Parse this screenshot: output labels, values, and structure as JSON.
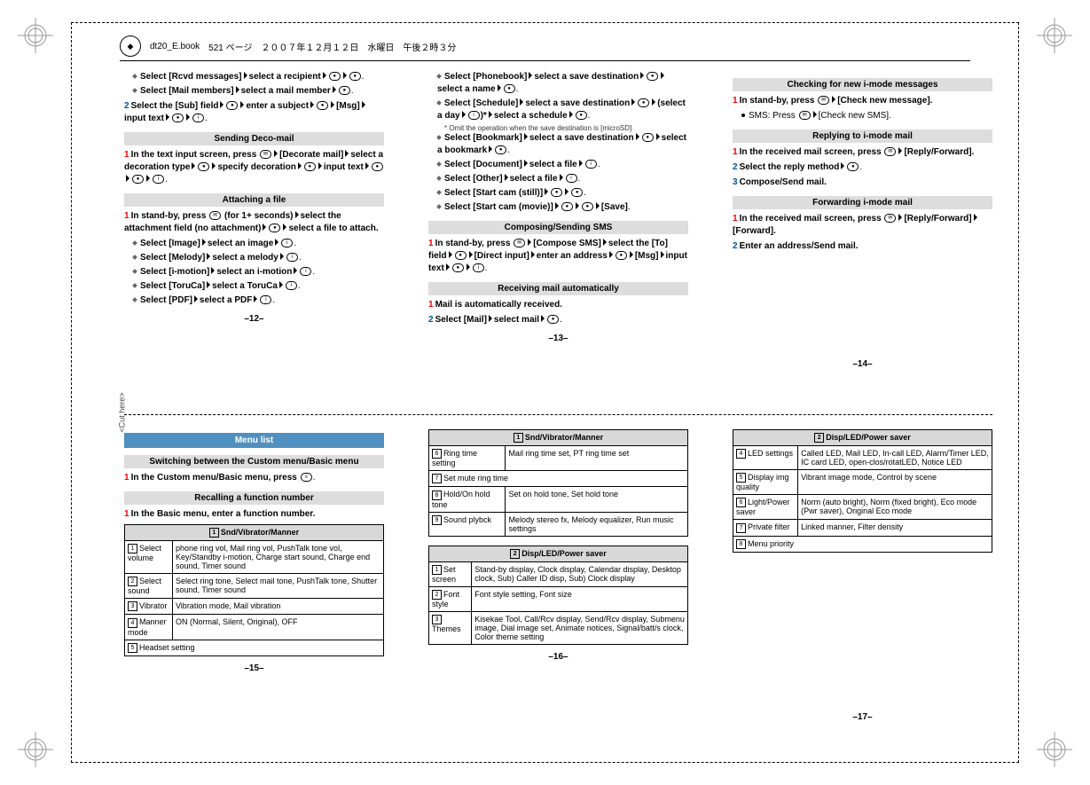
{
  "header": {
    "book": "dt20_E.book",
    "page": "521 ページ",
    "date": "２００７年１２月１２日　水曜日　午後２時３分"
  },
  "cut_here": "<Cut here>",
  "page12": {
    "rcvd": "Select [Rcvd messages]",
    "rcvd2": "select a recipient",
    "mailmem": "Select [Mail members]",
    "mailmem2": "select a mail member",
    "step2": "Select the [Sub] field",
    "step2b": "enter a subject",
    "step2c": "[Msg]",
    "step2d": "input text",
    "deco_head": "Sending Deco-mail",
    "deco1": "In the text input screen, press",
    "deco1b": "[Decorate mail]",
    "deco1c": "select a decoration type",
    "deco1d": "specify decoration",
    "deco1e": "input text",
    "attach_head": "Attaching a file",
    "attach1": "In stand-by, press",
    "attach1b": "(for 1+ seconds)",
    "attach1c": "select the attachment field (no attachment)",
    "attach1d": "select a file to attach.",
    "img": "Select [Image]",
    "img2": "select an image",
    "mel": "Select [Melody]",
    "mel2": "select a melody",
    "imot": "Select [i-motion]",
    "imot2": "select an i-motion",
    "toru": "Select [ToruCa]",
    "toru2": "select a ToruCa",
    "pdf": "Select [PDF]",
    "pdf2": "select a PDF",
    "pnum": "–12–"
  },
  "page13": {
    "pb": "Select [Phonebook]",
    "pb2": "select a save destination",
    "pb3": "select a name",
    "sch": "Select [Schedule]",
    "sch2": "select a save destination",
    "sch3": "(select a day",
    "sch4": "select a schedule",
    "note": "Omit the operation when the save destination is [microSD]",
    "bk": "Select [Bookmark]",
    "bk2": "select a save destination",
    "bk3": "select a bookmark",
    "doc": "Select [Document]",
    "doc2": "select a file",
    "oth": "Select [Other]",
    "oth2": "select a file",
    "still": "Select [Start cam (still)]",
    "mov": "Select [Start cam (movie)]",
    "mov2": "[Save]",
    "sms_head": "Composing/Sending SMS",
    "sms1": "In stand-by, press",
    "sms1b": "[Compose SMS]",
    "sms1c": "select the [To] field",
    "sms1d": "[Direct input]",
    "sms1e": "enter an address",
    "sms1f": "[Msg]",
    "sms1g": "input text",
    "recv_head": "Receiving mail automatically",
    "recv1": "Mail is automatically received.",
    "recv2": "Select [Mail]",
    "recv2b": "select mail",
    "pnum": "–13–"
  },
  "page14": {
    "check_head": "Checking for new i-mode messages",
    "check1": "In stand-by, press",
    "check1b": "[Check new message].",
    "check_sms": "SMS: Press",
    "check_sms2": "[Check new SMS].",
    "reply_head": "Replying to i-mode mail",
    "reply1": "In the received mail screen, press",
    "reply1b": "[Reply/Forward].",
    "reply2": "Select the reply method",
    "reply3": "Compose/Send mail.",
    "fwd_head": "Forwarding i-mode mail",
    "fwd1": "In the received mail screen, press",
    "fwd1b": "[Reply/Forward]",
    "fwd1c": "[Forward].",
    "fwd2": "Enter an address/Send mail.",
    "pnum": "–14–"
  },
  "page15": {
    "menu_head": "Menu list",
    "switch_head": "Switching between the Custom menu/Basic menu",
    "switch1": "In the Custom menu/Basic menu, press",
    "recall_head": "Recalling a function number",
    "recall1": "In the Basic menu, enter a function number.",
    "table_head": "Snd/Vibrator/Manner",
    "th_num": "1",
    "r1": "Select volume",
    "r1v": "phone ring vol, Mail ring vol, PushTalk tone vol, Key/Standby i-motion, Charge start sound, Charge end sound, Timer sound",
    "r2": "Select sound",
    "r2v": "Select ring tone, Select mail tone, PushTalk tone, Shutter sound, Timer sound",
    "r3": "Vibrator",
    "r3v": "Vibration mode, Mail vibration",
    "r4": "Manner mode",
    "r4v": "ON (Normal, Silent, Original), OFF",
    "r5": "Headset setting",
    "pnum": "–15–"
  },
  "page16": {
    "t1_head": "Snd/Vibrator/Manner",
    "t1_num": "1",
    "t1r6": "Ring time setting",
    "t1r6v": "Mail ring time set, PT ring time set",
    "t1r7": "Set mute ring time",
    "t1r8": "Hold/On hold tone",
    "t1r8v": "Set on hold tone, Set hold tone",
    "t1r9": "Sound plybck",
    "t1r9v": "Melody stereo fx, Melody equalizer, Run music settings",
    "t2_head": "Disp/LED/Power saver",
    "t2_num": "2",
    "t2r1": "Set screen",
    "t2r1v": "Stand-by display, Clock display, Calendar display, Desktop clock, Sub) Caller ID disp, Sub) Clock display",
    "t2r2": "Font style",
    "t2r2v": "Font style setting, Font size",
    "t2r3": "Themes",
    "t2r3v": "Kisekae Tool, Call/Rcv display, Send/Rcv display, Submenu image, Dial image set, Animate notices, Signal/batt/s clock, Color theme setting",
    "pnum": "–16–"
  },
  "page17": {
    "t2_head": "Disp/LED/Power saver",
    "t2_num": "2",
    "t2r4": "LED settings",
    "t2r4v": "Called LED, Mail LED, In-call LED, Alarm/Timer LED, IC card LED, open-clos/rotatLED, Notice LED",
    "t2r5": "Display img quality",
    "t2r5v": "Vibrant image mode, Control by scene",
    "t2r6": "Light/Power saver",
    "t2r6v": "Norm (auto bright), Norm (fixed bright), Eco mode (Pwr saver), Original Eco mode",
    "t2r7": "Private filter",
    "t2r7v": "Linked manner, Filter density",
    "t2r8": "Menu priority",
    "pnum": "–17–"
  }
}
